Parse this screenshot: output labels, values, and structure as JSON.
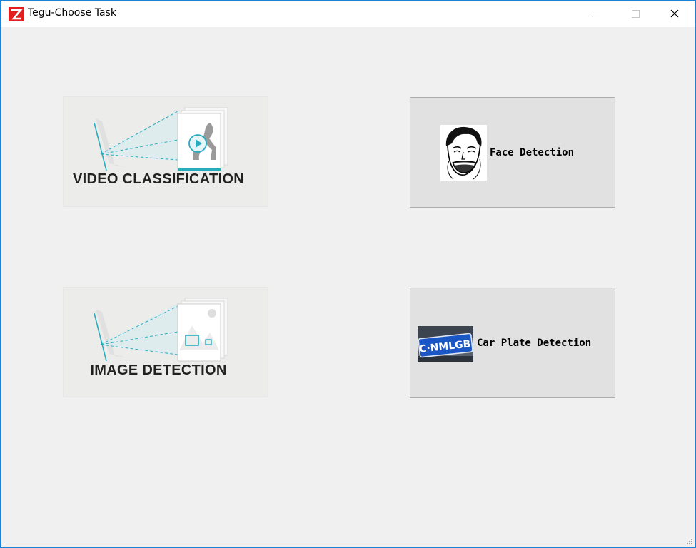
{
  "window": {
    "title": "Tegu-Choose Task",
    "accent": "#1883d7"
  },
  "tasks": {
    "video": {
      "label": "VIDEO CLASSIFICATION"
    },
    "image": {
      "label": "IMAGE DETECTION"
    },
    "face": {
      "label": "Face Detection"
    },
    "plate": {
      "label": "Car Plate Detection",
      "plate_text": "C·NMLGB"
    }
  },
  "colors": {
    "illustration_accent": "#2aacbf",
    "plate_blue": "#1a56c4",
    "brand_red": "#e02020"
  }
}
